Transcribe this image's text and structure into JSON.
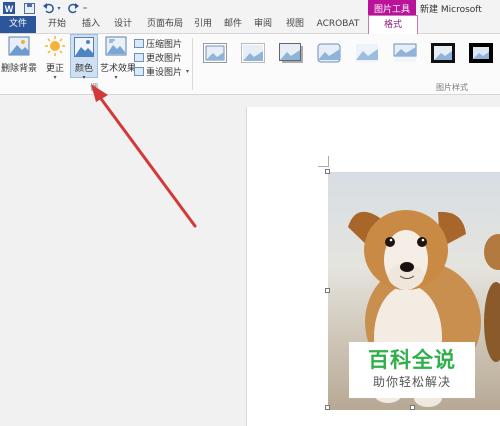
{
  "titlebar": {
    "context_tab_group": "图片工具",
    "document_title": "新建 Microsoft"
  },
  "tabs": [
    "文件",
    "开始",
    "插入",
    "设计",
    "页面布局",
    "引用",
    "邮件",
    "审阅",
    "视图",
    "ACROBAT",
    "格式"
  ],
  "active_tab": "格式",
  "ribbon": {
    "adjust_group": {
      "remove_background": "删除背景",
      "corrections": "更正",
      "color": "颜色",
      "artistic_effects": "艺术效果",
      "compress_pictures": "压缩图片",
      "change_picture": "更改图片",
      "reset_picture": "重设图片",
      "group_label": "调"
    },
    "picture_styles_group": {
      "group_label": "图片样式"
    }
  },
  "watermark": {
    "title": "百科全说",
    "subtitle": "助你轻松解决"
  },
  "colors": {
    "file_tab": "#2b579a",
    "format_context": "#b9139a",
    "arrow": "#d23a3a",
    "watermark_green": "#2fb04a"
  }
}
